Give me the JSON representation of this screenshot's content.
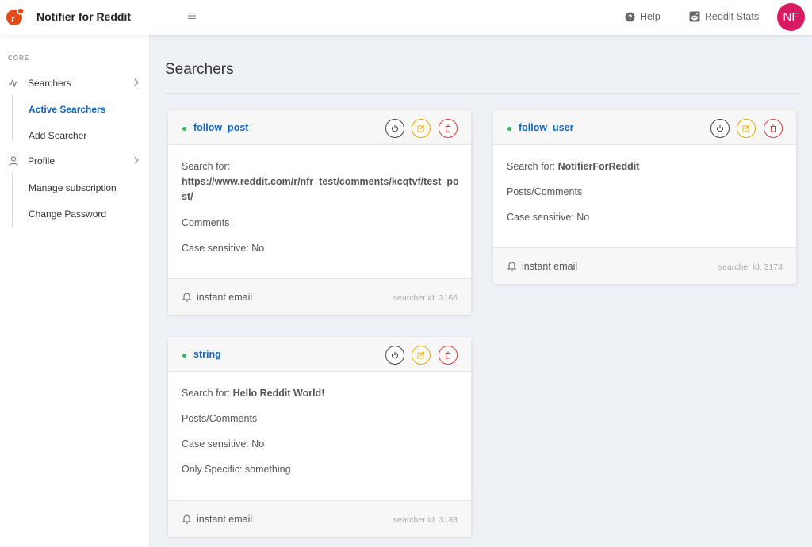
{
  "app": {
    "title": "Notifier for Reddit",
    "help_label": "Help",
    "stats_label": "Reddit Stats",
    "avatar_initials": "NF",
    "brand_color": "#e64a19",
    "avatar_color": "#d81b60"
  },
  "sidebar": {
    "heading": "CORE",
    "searchers_label": "Searchers",
    "active_searchers_label": "Active Searchers",
    "add_searcher_label": "Add Searcher",
    "profile_label": "Profile",
    "manage_subscription_label": "Manage subscription",
    "change_password_label": "Change Password"
  },
  "page": {
    "title": "Searchers"
  },
  "cards": [
    {
      "name": "follow_post",
      "search_label": "Search for:",
      "search_value": "https://www.reddit.com/r/nfr_test/comments/kcqtvf/test_post/",
      "type": "Comments",
      "case_sensitive": "Case sensitive: No",
      "notify": "instant email",
      "searcher_id": "searcher id: 3166"
    },
    {
      "name": "follow_user",
      "search_label": "Search for:",
      "search_value": "NotifierForReddit",
      "type": "Posts/Comments",
      "case_sensitive": "Case sensitive: No",
      "notify": "instant email",
      "searcher_id": "searcher id: 3174"
    },
    {
      "name": "string",
      "search_label": "Search for:",
      "search_value": "Hello Reddit World!",
      "type": "Posts/Comments",
      "case_sensitive": "Case sensitive: No",
      "only_specific": "Only Specific: something",
      "notify": "instant email",
      "searcher_id": "searcher id: 3183"
    }
  ],
  "colors": {
    "link": "#1565c0",
    "active_dot": "#2eb85c",
    "edit": "#f0a500",
    "delete": "#e53935"
  }
}
